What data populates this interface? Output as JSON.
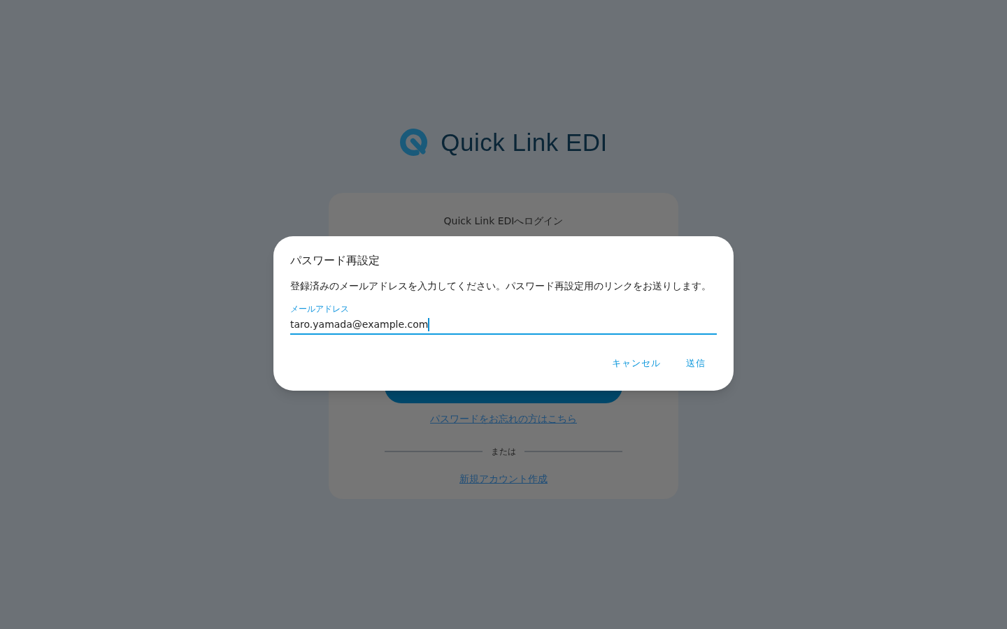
{
  "logo": {
    "text": "Quick Link EDI"
  },
  "login_card": {
    "title": "Quick Link EDIへログイン",
    "forgot_password_link": "パスワードをお忘れの方はこちら",
    "divider_text": "または",
    "signup_link": "新規アカウント作成"
  },
  "dialog": {
    "title": "パスワード再設定",
    "description": "登録済みのメールアドレスを入力してください。パスワード再設定用のリンクをお送りします。",
    "email_field": {
      "label": "メールアドレス",
      "value": "taro.yamada@example.com",
      "focused": true
    },
    "buttons": [
      {
        "label": "キャンセル"
      },
      {
        "label": "送信"
      }
    ]
  }
}
